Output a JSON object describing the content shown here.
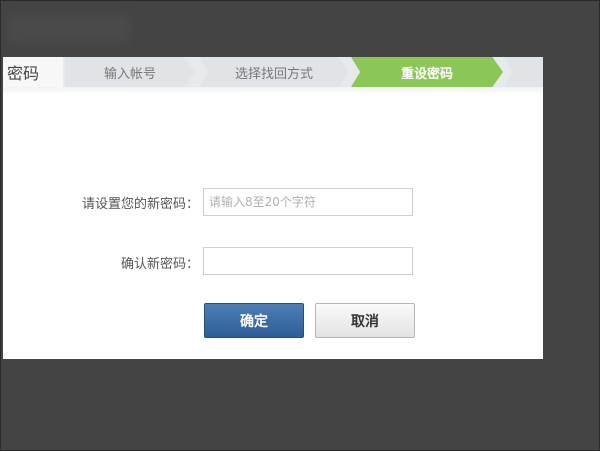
{
  "steps": {
    "title": "密码",
    "items": [
      {
        "label": "输入帐号",
        "state": "done"
      },
      {
        "label": "选择找回方式",
        "state": "done"
      },
      {
        "label": "重设密码",
        "state": "active"
      }
    ]
  },
  "form": {
    "new_password": {
      "label": "请设置您的新密码：",
      "placeholder": "请输入8至20个字符",
      "value": ""
    },
    "confirm_password": {
      "label": "确认新密码：",
      "placeholder": "",
      "value": ""
    }
  },
  "buttons": {
    "ok": "确定",
    "cancel": "取消"
  },
  "colors": {
    "active_step": "#8cc657",
    "primary_button": "#2c5d96",
    "backdrop": "#444444"
  }
}
